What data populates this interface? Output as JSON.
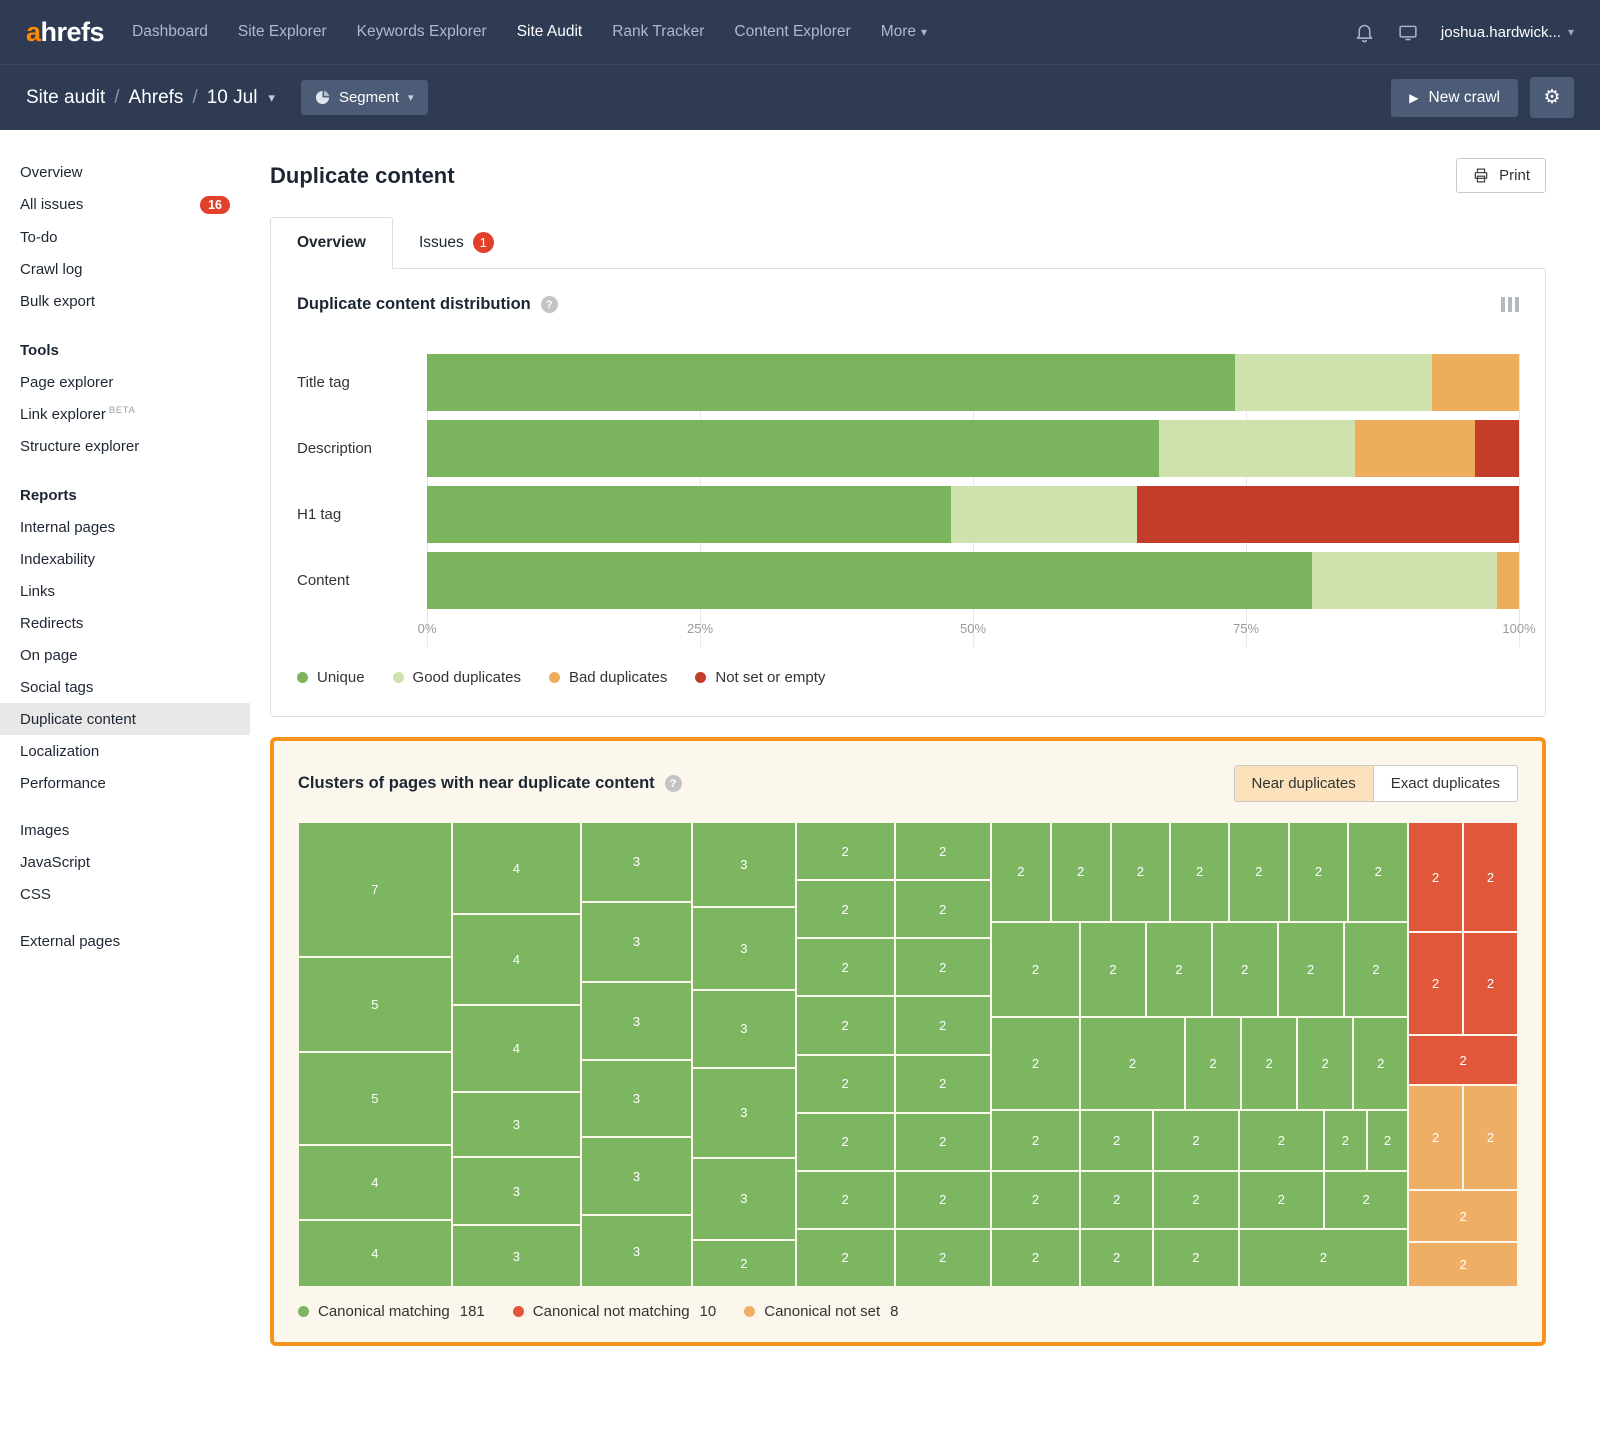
{
  "icons": {
    "help": "?",
    "caret": "▾",
    "play": "▶",
    "gear": "⚙",
    "slash": "/"
  },
  "nav": {
    "logo_accent": "a",
    "logo_rest": "hrefs",
    "items": [
      {
        "label": "Dashboard"
      },
      {
        "label": "Site Explorer"
      },
      {
        "label": "Keywords Explorer"
      },
      {
        "label": "Site Audit",
        "active": true
      },
      {
        "label": "Rank Tracker"
      },
      {
        "label": "Content Explorer"
      },
      {
        "label": "More",
        "caret": true
      }
    ],
    "user": "joshua.hardwick..."
  },
  "subheader": {
    "breadcrumb": [
      "Site audit",
      "Ahrefs",
      "10 Jul"
    ],
    "segment": "Segment",
    "new_crawl": "New crawl"
  },
  "sidebar": {
    "groups": [
      {
        "items": [
          {
            "label": "Overview"
          },
          {
            "label": "All issues",
            "badge": "16"
          },
          {
            "label": "To-do"
          },
          {
            "label": "Crawl log"
          },
          {
            "label": "Bulk export"
          }
        ]
      },
      {
        "header": "Tools",
        "items": [
          {
            "label": "Page explorer"
          },
          {
            "label": "Link explorer",
            "sup": "BETA"
          },
          {
            "label": "Structure explorer"
          }
        ]
      },
      {
        "header": "Reports",
        "items": [
          {
            "label": "Internal pages"
          },
          {
            "label": "Indexability"
          },
          {
            "label": "Links"
          },
          {
            "label": "Redirects"
          },
          {
            "label": "On page"
          },
          {
            "label": "Social tags"
          },
          {
            "label": "Duplicate content",
            "selected": true
          },
          {
            "label": "Localization"
          },
          {
            "label": "Performance"
          }
        ]
      },
      {
        "items": [
          {
            "label": "Images"
          },
          {
            "label": "JavaScript"
          },
          {
            "label": "CSS"
          }
        ]
      },
      {
        "items": [
          {
            "label": "External pages"
          }
        ]
      }
    ]
  },
  "main": {
    "title": "Duplicate content",
    "print": "Print",
    "tabs": [
      {
        "label": "Overview",
        "active": true
      },
      {
        "label": "Issues",
        "badge": "1"
      }
    ]
  },
  "chart_data": [
    {
      "type": "bar",
      "variant": "horizontal-stacked-percent",
      "title": "Duplicate content distribution",
      "categories": [
        "Title tag",
        "Description",
        "H1 tag",
        "Content"
      ],
      "series": [
        {
          "name": "Unique",
          "color": "#7ab55e",
          "values": [
            74,
            67,
            48,
            81
          ]
        },
        {
          "name": "Good duplicates",
          "color": "#cfe2ad",
          "values": [
            18,
            18,
            17,
            17
          ]
        },
        {
          "name": "Bad duplicates",
          "color": "#edad5c",
          "values": [
            8,
            11,
            0,
            2
          ]
        },
        {
          "name": "Not set or empty",
          "color": "#c33d2a",
          "values": [
            0,
            4,
            35,
            0
          ]
        }
      ],
      "x_ticks": [
        "0%",
        "25%",
        "50%",
        "75%",
        "100%"
      ],
      "xlim": [
        0,
        100
      ],
      "grid": true,
      "legend_position": "bottom"
    },
    {
      "type": "treemap",
      "title": "Clusters of pages with near duplicate content",
      "toggle": [
        {
          "label": "Near duplicates",
          "active": true
        },
        {
          "label": "Exact duplicates",
          "active": false
        }
      ],
      "legend": [
        {
          "label": "Canonical matching",
          "count": 181,
          "color": "#7cb661"
        },
        {
          "label": "Canonical not matching",
          "count": 10,
          "color": "#e0573a"
        },
        {
          "label": "Canonical not set",
          "count": 8,
          "color": "#efae66"
        }
      ],
      "cells": [
        [
          7,
          0,
          0,
          12.6,
          29,
          "g"
        ],
        [
          5,
          0,
          29,
          12.6,
          20.4,
          "g"
        ],
        [
          5,
          0,
          49.4,
          12.6,
          20,
          "g"
        ],
        [
          4,
          0,
          69.4,
          12.6,
          16.1,
          "g"
        ],
        [
          4,
          0,
          85.5,
          12.6,
          14.5,
          "g"
        ],
        [
          4,
          12.6,
          0,
          10.6,
          19.8,
          "g"
        ],
        [
          4,
          12.6,
          19.8,
          10.6,
          19.6,
          "g"
        ],
        [
          4,
          12.6,
          39.4,
          10.6,
          18.7,
          "g"
        ],
        [
          3,
          12.6,
          58.1,
          10.6,
          14,
          "g"
        ],
        [
          3,
          12.6,
          72.1,
          10.6,
          14.6,
          "g"
        ],
        [
          3,
          12.6,
          86.7,
          10.6,
          13.3,
          "g"
        ],
        [
          3,
          23.2,
          0,
          9.1,
          17.2,
          "g"
        ],
        [
          3,
          23.2,
          17.2,
          9.1,
          17.2,
          "g"
        ],
        [
          3,
          23.2,
          34.4,
          9.1,
          16.8,
          "g"
        ],
        [
          3,
          23.2,
          51.2,
          9.1,
          16.6,
          "g"
        ],
        [
          3,
          23.2,
          67.8,
          9.1,
          16.8,
          "g"
        ],
        [
          3,
          23.2,
          84.6,
          9.1,
          15.4,
          "g"
        ],
        [
          3,
          32.3,
          0,
          8.5,
          18.3,
          "g"
        ],
        [
          3,
          32.3,
          18.3,
          8.5,
          17.9,
          "g"
        ],
        [
          3,
          32.3,
          36.2,
          8.5,
          16.6,
          "g"
        ],
        [
          3,
          32.3,
          52.8,
          8.5,
          19.4,
          "g"
        ],
        [
          3,
          32.3,
          72.2,
          8.5,
          17.6,
          "g"
        ],
        [
          2,
          32.3,
          89.8,
          8.5,
          10.2,
          "g"
        ],
        [
          2,
          40.8,
          0,
          8.1,
          12.5,
          "g"
        ],
        [
          2,
          40.8,
          12.5,
          8.1,
          12.5,
          "g"
        ],
        [
          2,
          40.8,
          25,
          8.1,
          12.5,
          "g"
        ],
        [
          2,
          40.8,
          37.5,
          8.1,
          12.5,
          "g"
        ],
        [
          2,
          40.8,
          50,
          8.1,
          12.5,
          "g"
        ],
        [
          2,
          40.8,
          62.5,
          8.1,
          12.5,
          "g"
        ],
        [
          2,
          40.8,
          75,
          8.1,
          12.5,
          "g"
        ],
        [
          2,
          40.8,
          87.5,
          8.1,
          12.5,
          "g"
        ],
        [
          2,
          48.9,
          0,
          7.9,
          12.5,
          "g"
        ],
        [
          2,
          48.9,
          12.5,
          7.9,
          12.5,
          "g"
        ],
        [
          2,
          48.9,
          25,
          7.9,
          12.5,
          "g"
        ],
        [
          2,
          48.9,
          37.5,
          7.9,
          12.5,
          "g"
        ],
        [
          2,
          48.9,
          50,
          7.9,
          12.5,
          "g"
        ],
        [
          2,
          48.9,
          62.5,
          7.9,
          12.5,
          "g"
        ],
        [
          2,
          48.9,
          75,
          7.9,
          12.5,
          "g"
        ],
        [
          2,
          48.9,
          87.5,
          7.9,
          12.5,
          "g"
        ],
        [
          2,
          56.8,
          0,
          4.9,
          21.5,
          "g"
        ],
        [
          2,
          61.7,
          0,
          4.9,
          21.5,
          "g"
        ],
        [
          2,
          66.6,
          0,
          4.9,
          21.5,
          "g"
        ],
        [
          2,
          71.5,
          0,
          4.8,
          21.5,
          "g"
        ],
        [
          2,
          76.3,
          0,
          4.9,
          21.5,
          "g"
        ],
        [
          2,
          81.2,
          0,
          4.9,
          21.5,
          "g"
        ],
        [
          2,
          86.1,
          0,
          4.9,
          21.5,
          "g"
        ],
        [
          2,
          56.8,
          21.5,
          7.3,
          20.5,
          "g"
        ],
        [
          2,
          64.1,
          21.5,
          5.4,
          20.5,
          "g"
        ],
        [
          2,
          69.5,
          21.5,
          5.4,
          20.5,
          "g"
        ],
        [
          2,
          74.9,
          21.5,
          5.4,
          20.5,
          "g"
        ],
        [
          2,
          80.3,
          21.5,
          5.4,
          20.5,
          "g"
        ],
        [
          2,
          85.7,
          21.5,
          5.3,
          20.5,
          "g"
        ],
        [
          2,
          56.8,
          42,
          7.3,
          20,
          "g"
        ],
        [
          2,
          64.1,
          42,
          8.6,
          20,
          "g"
        ],
        [
          2,
          72.7,
          42,
          4.6,
          20,
          "g"
        ],
        [
          2,
          77.3,
          42,
          4.6,
          20,
          "g"
        ],
        [
          2,
          81.9,
          42,
          4.6,
          20,
          "g"
        ],
        [
          2,
          86.5,
          42,
          4.5,
          20,
          "g"
        ],
        [
          2,
          56.8,
          62,
          7.3,
          13,
          "g"
        ],
        [
          2,
          64.1,
          62,
          6,
          13,
          "g"
        ],
        [
          2,
          70.1,
          62,
          7,
          13,
          "g"
        ],
        [
          2,
          77.1,
          62,
          7,
          13,
          "g"
        ],
        [
          2,
          84.1,
          62,
          3.5,
          13,
          "g"
        ],
        [
          2,
          87.6,
          62,
          3.4,
          13,
          "g"
        ],
        [
          2,
          56.8,
          75,
          7.3,
          12.5,
          "g"
        ],
        [
          2,
          64.1,
          75,
          6,
          12.5,
          "g"
        ],
        [
          2,
          70.1,
          75,
          7,
          12.5,
          "g"
        ],
        [
          2,
          77.1,
          75,
          7,
          12.5,
          "g"
        ],
        [
          2,
          84.1,
          75,
          6.9,
          12.5,
          "g"
        ],
        [
          2,
          56.8,
          87.5,
          7.3,
          12.5,
          "g"
        ],
        [
          2,
          64.1,
          87.5,
          6,
          12.5,
          "g"
        ],
        [
          2,
          70.1,
          87.5,
          7,
          12.5,
          "g"
        ],
        [
          2,
          77.1,
          87.5,
          13.9,
          12.5,
          "g"
        ],
        [
          2,
          91,
          0,
          4.5,
          23.7,
          "r"
        ],
        [
          2,
          95.5,
          0,
          4.5,
          23.7,
          "r"
        ],
        [
          2,
          91,
          23.7,
          4.5,
          22.1,
          "r"
        ],
        [
          2,
          95.5,
          23.7,
          4.5,
          22.1,
          "r"
        ],
        [
          2,
          91,
          45.8,
          9,
          10.8,
          "r"
        ],
        [
          2,
          91,
          56.6,
          4.5,
          22.6,
          "o"
        ],
        [
          2,
          95.5,
          56.6,
          4.5,
          22.6,
          "o"
        ],
        [
          2,
          91,
          79.2,
          9,
          11.2,
          "o"
        ],
        [
          2,
          91,
          90.4,
          9,
          9.6,
          "o"
        ]
      ]
    }
  ]
}
